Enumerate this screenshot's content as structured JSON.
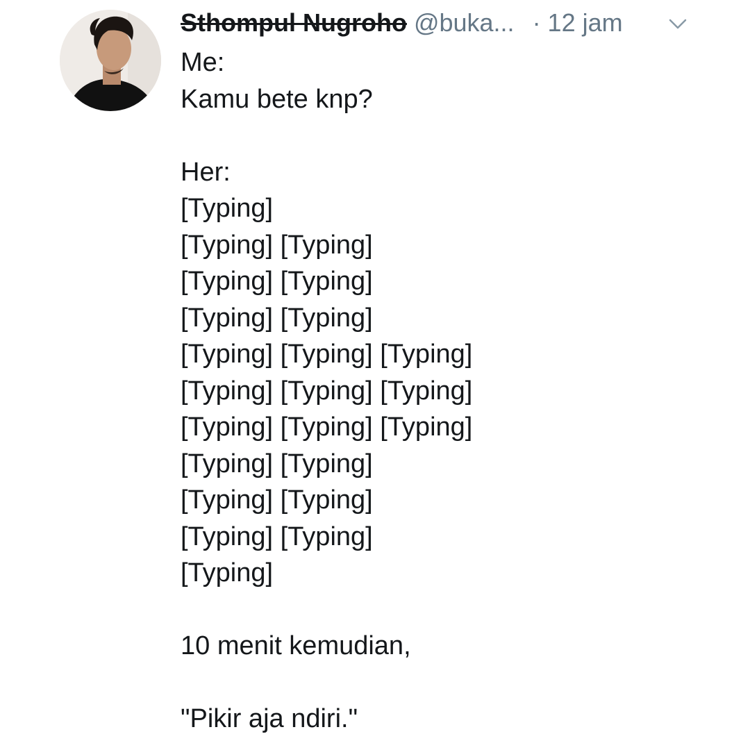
{
  "author": {
    "display_name": "Sthompul Nugroho",
    "handle": "@buka...",
    "timestamp": "· 12 jam"
  },
  "icons": {
    "avatar": "profile-photo",
    "caret": "chevron-down-icon"
  },
  "colors": {
    "text": "#14171a",
    "secondary": "#657786",
    "background": "#ffffff"
  },
  "tweet": {
    "me_label": "Me:",
    "question": "Kamu bete knp?",
    "her_label": "Her:",
    "typing_lines": [
      "[Typing]",
      "[Typing] [Typing]",
      "[Typing] [Typing]",
      "[Typing] [Typing]",
      "[Typing] [Typing] [Typing]",
      "[Typing] [Typing] [Typing]",
      "[Typing] [Typing] [Typing]",
      "[Typing] [Typing]",
      "[Typing] [Typing]",
      "[Typing] [Typing]",
      "[Typing]"
    ],
    "later": "10 menit kemudian,",
    "reply": "\"Pikir aja ndiri.\""
  }
}
